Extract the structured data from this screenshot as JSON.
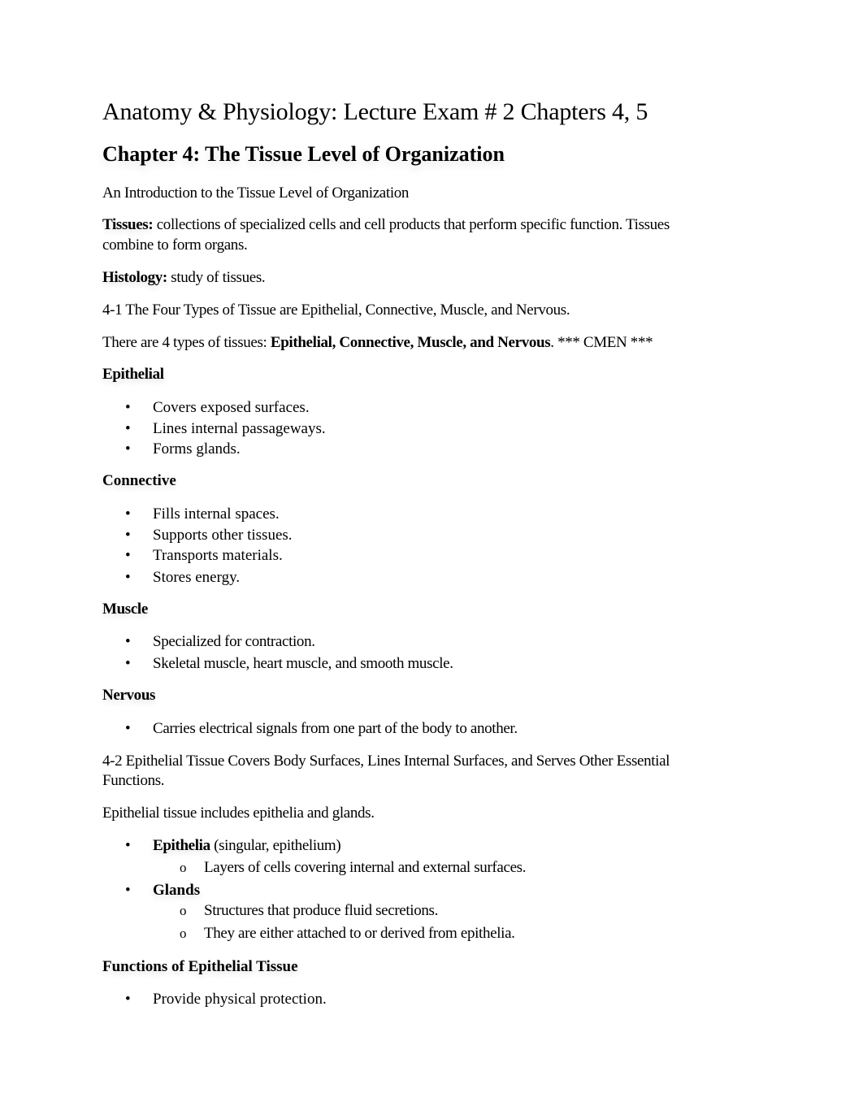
{
  "document": {
    "title": "Anatomy & Physiology: Lecture Exam # 2 Chapters 4, 5",
    "chapter_heading": "Chapter 4: The Tissue Level of Organization",
    "intro": "An Introduction to the Tissue Level of Organization",
    "tissues_term": "Tissues:",
    "tissues_def_line1": " collections of specialized cells and cell products that perform specific function. Tissues",
    "tissues_def_line2": "combine to form organs.",
    "histology_term": "Histology:",
    "histology_def": " study of tissues.",
    "section_4_1": "4-1 The Four Types of Tissue are Epithelial, Connective, Muscle, and Nervous.",
    "types_prefix": "There are 4 types of tissues: ",
    "types_bold": "Epithelial, Connective, Muscle, and Nervous",
    "types_suffix": ". *** CMEN ***",
    "epithelial": {
      "heading": "Epithelial",
      "items": [
        "Covers exposed surfaces.",
        "Lines internal passageways.",
        "Forms glands."
      ]
    },
    "connective": {
      "heading": "Connective",
      "items": [
        "Fills internal spaces.",
        "Supports other tissues.",
        "Transports materials.",
        "Stores energy."
      ]
    },
    "muscle": {
      "heading": "Muscle",
      "items": [
        "Specialized for contraction.",
        "Skeletal muscle, heart muscle, and smooth muscle."
      ]
    },
    "nervous": {
      "heading": "Nervous",
      "items": [
        "Carries electrical signals from one part of the body to another."
      ]
    },
    "section_4_2_line1": "4-2 Epithelial Tissue Covers Body Surfaces, Lines Internal Surfaces, and Serves Other Essential",
    "section_4_2_line2": "Functions.",
    "epithelial_includes": "Epithelial tissue includes epithelia and glands.",
    "epithelia_item": {
      "term": "Epithelia",
      "note": " (singular, epithelium)",
      "sub": [
        "Layers of cells covering internal and external surfaces."
      ]
    },
    "glands_item": {
      "term": "Glands",
      "sub": [
        "Structures that produce fluid secretions.",
        "They are either attached to or derived from epithelia."
      ]
    },
    "functions": {
      "heading": "Functions of Epithelial Tissue",
      "items": [
        "Provide physical protection."
      ]
    },
    "bullet_glyph": "•",
    "sub_bullet_glyph": "o"
  }
}
